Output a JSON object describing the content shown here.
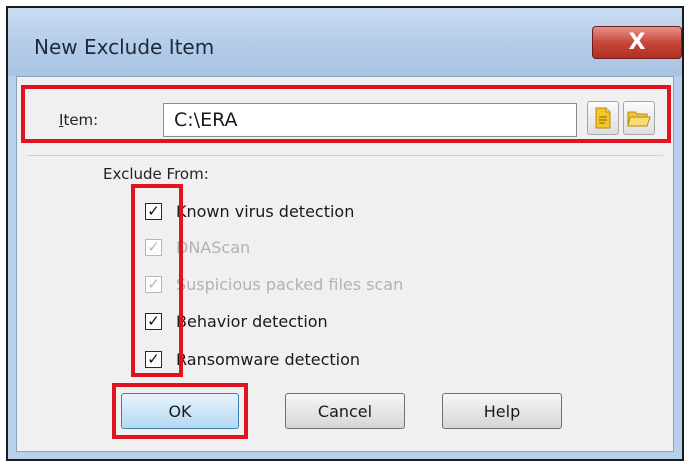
{
  "window": {
    "title": "New Exclude Item",
    "close_glyph": "X"
  },
  "item": {
    "label": "Item:",
    "value": "C:\\ERA",
    "buttons": [
      "file-icon",
      "folder-icon"
    ]
  },
  "exclude_from": {
    "label": "Exclude From:",
    "options": [
      {
        "label": "Known virus detection",
        "checked": true,
        "enabled": true
      },
      {
        "label": "DNAScan",
        "checked": true,
        "enabled": false
      },
      {
        "label": "Suspicious packed files scan",
        "checked": true,
        "enabled": false
      },
      {
        "label": "Behavior detection",
        "checked": true,
        "enabled": true
      },
      {
        "label": "Ransomware detection",
        "checked": true,
        "enabled": true
      }
    ]
  },
  "buttons": {
    "ok": "OK",
    "cancel": "Cancel",
    "help": "Help"
  },
  "colors": {
    "highlight": "#e0141e",
    "titlebar": "#b9d0ea",
    "close": "#c8473b"
  }
}
